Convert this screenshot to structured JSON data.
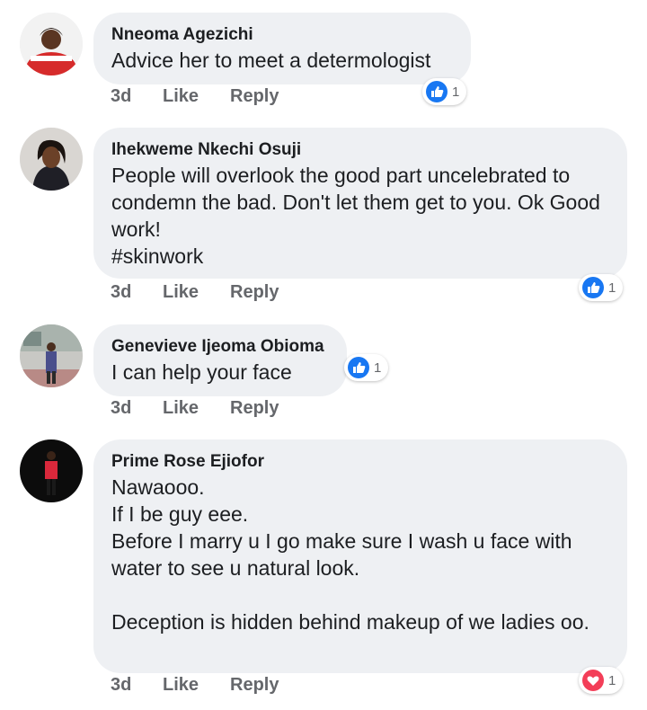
{
  "comments": [
    {
      "author": "Nneoma Agezichi",
      "text": "Advice her to meet a determologist",
      "time": "3d",
      "like_label": "Like",
      "reply_label": "Reply",
      "reaction": {
        "type": "like",
        "icon": "thumbs-up-icon",
        "count": "1"
      }
    },
    {
      "author": "Ihekweme Nkechi Osuji",
      "text": "People will overlook the good part uncelebrated to condemn the bad. Don't let them get to you. Ok Good work!",
      "hashtag": "#skinwork",
      "time": "3d",
      "like_label": "Like",
      "reply_label": "Reply",
      "reaction": {
        "type": "like",
        "icon": "thumbs-up-icon",
        "count": "1"
      }
    },
    {
      "author": "Genevieve Ijeoma Obioma",
      "text": "I can help your face",
      "time": "3d",
      "like_label": "Like",
      "reply_label": "Reply",
      "reaction": {
        "type": "like",
        "icon": "thumbs-up-icon",
        "count": "1"
      }
    },
    {
      "author": "Prime Rose Ejiofor",
      "text": "Nawaooo.\nIf I be guy eee.\nBefore I marry u I go make sure I wash u face with water to see u natural look.\n\nDeception is hidden behind makeup of we ladies oo.",
      "time": "3d",
      "like_label": "Like",
      "reply_label": "Reply",
      "reaction": {
        "type": "love",
        "icon": "heart-icon",
        "count": "1"
      }
    }
  ],
  "colors": {
    "bubble": "#eef0f3",
    "like_blue": "#1877f2",
    "love_red": "#f33e58",
    "meta_gray": "#65676b"
  }
}
